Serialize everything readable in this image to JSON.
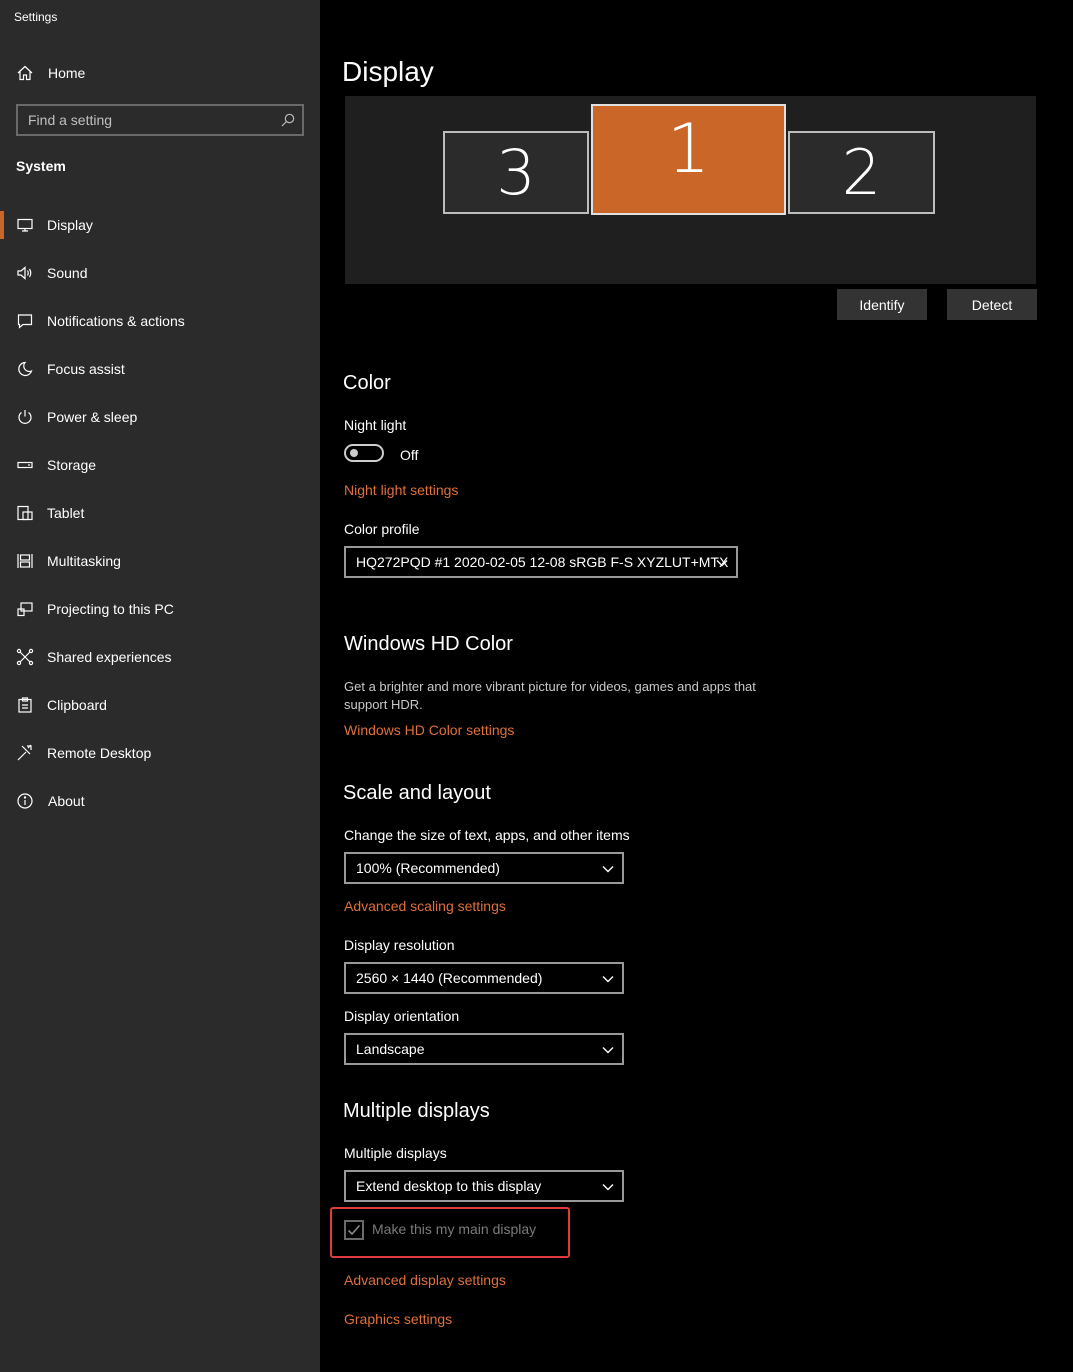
{
  "window": {
    "title": "Settings"
  },
  "sidebar": {
    "home_label": "Home",
    "search_placeholder": "Find a setting",
    "section": "System",
    "accent_color": "#c86729",
    "items": [
      {
        "label": "Display",
        "icon": "monitor-icon",
        "active": true
      },
      {
        "label": "Sound",
        "icon": "speaker-icon"
      },
      {
        "label": "Notifications & actions",
        "icon": "notification-icon"
      },
      {
        "label": "Focus assist",
        "icon": "moon-icon"
      },
      {
        "label": "Power & sleep",
        "icon": "power-icon"
      },
      {
        "label": "Storage",
        "icon": "storage-icon"
      },
      {
        "label": "Tablet",
        "icon": "tablet-icon"
      },
      {
        "label": "Multitasking",
        "icon": "multitasking-icon"
      },
      {
        "label": "Projecting to this PC",
        "icon": "projecting-icon"
      },
      {
        "label": "Shared experiences",
        "icon": "shared-experiences-icon"
      },
      {
        "label": "Clipboard",
        "icon": "clipboard-icon"
      },
      {
        "label": "Remote Desktop",
        "icon": "remote-desktop-icon"
      },
      {
        "label": "About",
        "icon": "info-icon"
      }
    ]
  },
  "main": {
    "title": "Display",
    "monitors": [
      {
        "label": "3",
        "selected": false
      },
      {
        "label": "1",
        "selected": true
      },
      {
        "label": "2",
        "selected": false
      }
    ],
    "identify_label": "Identify",
    "detect_label": "Detect",
    "color": {
      "heading": "Color",
      "night_light_label": "Night light",
      "night_light_state": "Off",
      "night_light_link": "Night light settings",
      "color_profile_label": "Color profile",
      "color_profile_value": "HQ272PQD #1 2020-02-05 12-08 sRGB F-S XYZLUT+MTX"
    },
    "hd_color": {
      "heading": "Windows HD Color",
      "description_line1": "Get a brighter and more vibrant picture for videos, games and apps that",
      "description_line2": "support HDR.",
      "link": "Windows HD Color settings"
    },
    "scale": {
      "heading": "Scale and layout",
      "size_label": "Change the size of text, apps, and other items",
      "size_value": "100% (Recommended)",
      "advanced_link": "Advanced scaling settings",
      "resolution_label": "Display resolution",
      "resolution_value": "2560 × 1440 (Recommended)",
      "orientation_label": "Display orientation",
      "orientation_value": "Landscape"
    },
    "multi": {
      "heading": "Multiple displays",
      "label": "Multiple displays",
      "value": "Extend desktop to this display",
      "main_display_label": "Make this my main display",
      "main_display_checked": true,
      "advanced_link": "Advanced display settings",
      "graphics_link": "Graphics settings"
    },
    "link_color": "#e0703a",
    "highlight_color": "#e03a3a"
  }
}
